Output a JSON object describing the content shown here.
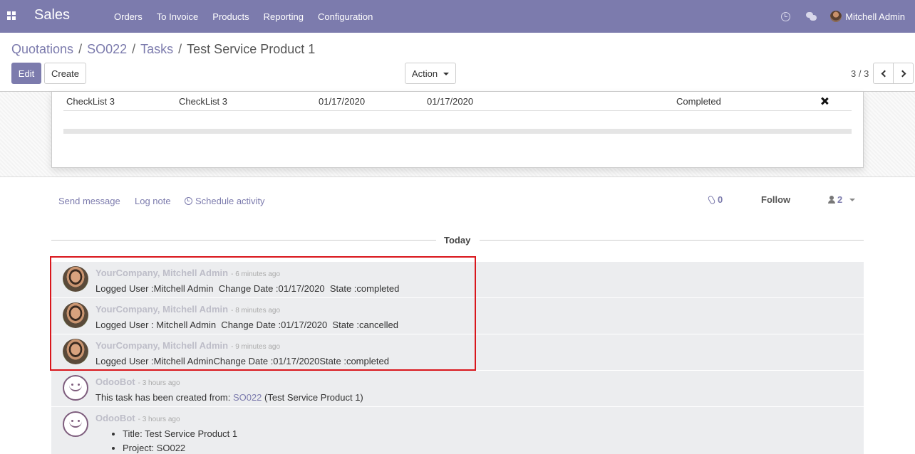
{
  "navbar": {
    "brand": "Sales",
    "menu": [
      "Orders",
      "To Invoice",
      "Products",
      "Reporting",
      "Configuration"
    ],
    "user_name": "Mitchell Admin"
  },
  "breadcrumb": {
    "items": [
      "Quotations",
      "SO022",
      "Tasks"
    ],
    "current": "Test Service Product 1"
  },
  "toolbar": {
    "edit_label": "Edit",
    "create_label": "Create",
    "action_label": "Action",
    "pager": "3 / 3"
  },
  "checklist_row": {
    "name": "CheckList 3",
    "description": "CheckList 3",
    "date_1": "01/17/2020",
    "date_2": "01/17/2020",
    "state": "Completed"
  },
  "chatter": {
    "send_message": "Send message",
    "log_note": "Log note",
    "schedule_activity": "Schedule activity",
    "attachments": "0",
    "follow": "Follow",
    "followers": "2",
    "today": "Today",
    "messages": [
      {
        "author": "YourCompany, Mitchell Admin",
        "date": "- 6 minutes ago",
        "body": "Logged User :Mitchell Admin  Change Date :01/17/2020  State :completed"
      },
      {
        "author": "YourCompany, Mitchell Admin",
        "date": "- 8 minutes ago",
        "body": "Logged User : Mitchell Admin  Change Date :01/17/2020  State :cancelled"
      },
      {
        "author": "YourCompany, Mitchell Admin",
        "date": "- 9 minutes ago",
        "body": "Logged User :Mitchell AdminChange Date :01/17/2020State :completed"
      },
      {
        "author": "OdooBot",
        "date": "- 3 hours ago",
        "body_prefix": "This task has been created from: ",
        "body_link": "SO022",
        "body_suffix": " (Test Service Product 1)"
      },
      {
        "author": "OdooBot",
        "date": "- 3 hours ago",
        "list": [
          "Title: Test Service Product 1",
          "Project: SO022"
        ]
      }
    ]
  },
  "colors": {
    "brand": "#7c7bad",
    "highlight": "#d9161c",
    "message_bg": "#ecedef"
  }
}
